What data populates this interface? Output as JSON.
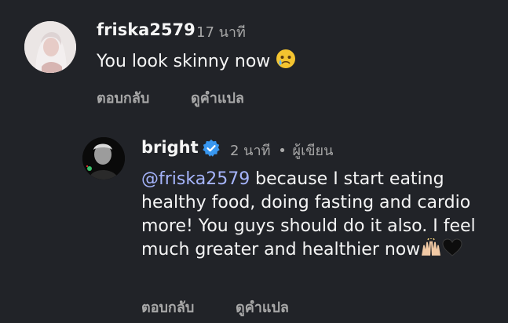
{
  "comments": [
    {
      "username": "friska2579",
      "time": "17 นาที",
      "text": "You look skinny now",
      "emoji": "crying-face",
      "actions": {
        "reply": "ตอบกลับ",
        "translate": "ดูคำแปล"
      }
    }
  ],
  "reply": {
    "username": "bright",
    "verified": true,
    "time": "2 นาที",
    "separator": "•",
    "author_tag": "ผู้เขียน",
    "mention": "@friska2579",
    "text": " because I start eating healthy food, doing fasting and cardio more! You guys should do it also. I feel much greater and healthier now",
    "emojis": [
      "raised-hands-emoji",
      "black-heart-emoji"
    ],
    "actions": {
      "reply": "ตอบกลับ",
      "translate": "ดูคำแปล"
    }
  },
  "colors": {
    "background": "#212328",
    "text": "#f5f5f5",
    "muted": "#a8a8a8",
    "mention": "#a5b4fc",
    "verified": "#3897f0"
  }
}
